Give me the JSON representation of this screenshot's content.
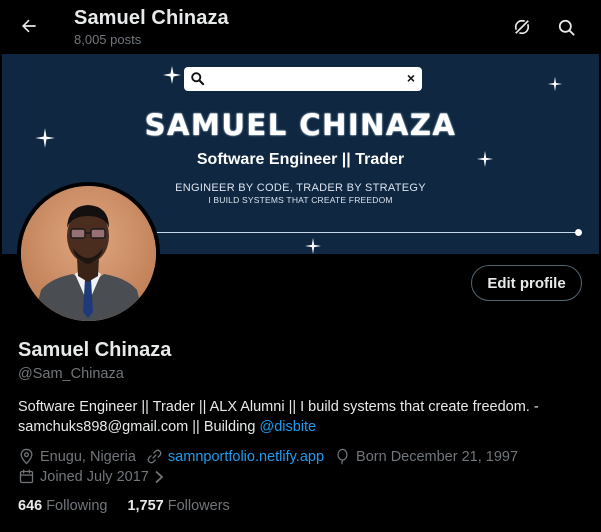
{
  "header": {
    "back_icon": "arrow-left-icon",
    "title": "Samuel Chinaza",
    "post_count": "8,005 posts",
    "grok_icon": "grok-icon",
    "search_icon": "search-icon"
  },
  "banner": {
    "search_clear": "×",
    "headline": "SAMUEL CHINAZA",
    "role": "Software Engineer || Trader",
    "tagline": "ENGINEER BY CODE, TRADER BY STRATEGY",
    "subtagline": "I BUILD SYSTEMS THAT CREATE FREEDOM",
    "background_color": "#0f2740"
  },
  "profile": {
    "edit_label": "Edit profile",
    "name": "Samuel Chinaza",
    "handle": "@Sam_Chinaza",
    "bio_text": "Software Engineer || Trader || ALX Alumni || I build systems that create freedom. - samchuks898@gmail.com || Building ",
    "bio_mention": "@disbite",
    "location": "Enugu, Nigeria",
    "website": "samnportfolio.netlify.app",
    "birthday": "Born December 21, 1997",
    "joined": "Joined July 2017"
  },
  "stats": {
    "following_count": "646",
    "following_label": "Following",
    "followers_count": "1,757",
    "followers_label": "Followers"
  },
  "colors": {
    "accent": "#1d9bf0",
    "muted": "#71767b",
    "text": "#e7e9ea",
    "background": "#000000"
  }
}
